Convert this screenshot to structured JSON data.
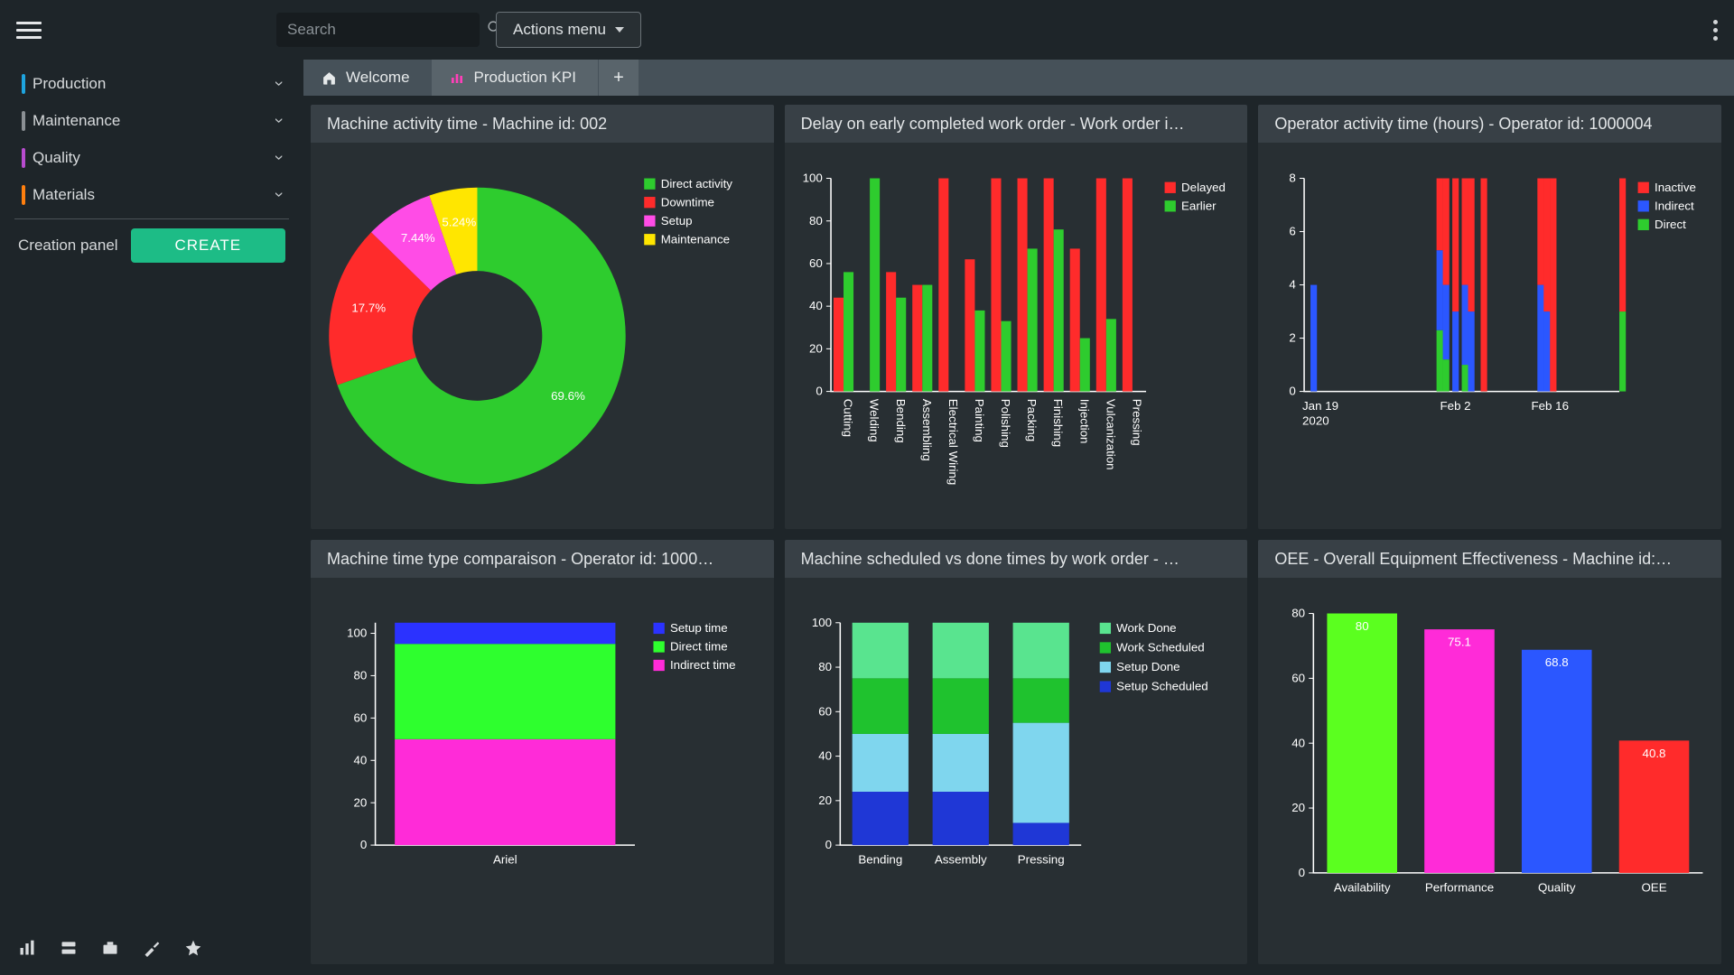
{
  "search": {
    "placeholder": "Search"
  },
  "actions_menu": "Actions menu",
  "sidebar": {
    "items": [
      {
        "label": "Production",
        "color": "#1ea4de"
      },
      {
        "label": "Maintenance",
        "color": "#8b9094"
      },
      {
        "label": "Quality",
        "color": "#b84ccf"
      },
      {
        "label": "Materials",
        "color": "#ff7f0e"
      }
    ],
    "creation_label": "Creation panel",
    "create_btn": "CREATE"
  },
  "tabs": [
    {
      "label": "Welcome",
      "active": false,
      "icon": "home"
    },
    {
      "label": "Production KPI",
      "active": true,
      "icon": "chart"
    }
  ],
  "cards": {
    "machine_activity": {
      "title": "Machine activity time - Machine id: 002"
    },
    "delay": {
      "title": "Delay on early completed work order - Work order i…"
    },
    "operator": {
      "title": "Operator activity time (hours) - Operator id: 1000004"
    },
    "comparaison": {
      "title": "Machine time type comparaison - Operator id: 1000…"
    },
    "scheduled": {
      "title": "Machine scheduled vs done times by work order - …"
    },
    "oee": {
      "title": "OEE - Overall Equipment Effectiveness - Machine id:…"
    }
  },
  "chart_data": [
    {
      "type": "pie",
      "title": "Machine activity time - Machine id: 002",
      "slices": [
        {
          "name": "Direct activity",
          "value": 69.6,
          "color": "#2ecc2e"
        },
        {
          "name": "Downtime",
          "value": 17.7,
          "color": "#ff2b2b"
        },
        {
          "name": "Setup",
          "value": 7.44,
          "color": "#ff4ce6"
        },
        {
          "name": "Maintenance",
          "value": 5.24,
          "color": "#ffe600"
        }
      ]
    },
    {
      "type": "bar",
      "title": "Delay on early completed work order",
      "categories": [
        "Cutting",
        "Welding",
        "Bending",
        "Assembling",
        "Electrical Wiring",
        "Painting",
        "Polishing",
        "Packing",
        "Finishing",
        "Injection",
        "Vulcanization",
        "Pressing"
      ],
      "series": [
        {
          "name": "Delayed",
          "color": "#ff2b2b",
          "values": [
            44,
            0,
            56,
            50,
            100,
            62,
            100,
            100,
            100,
            67,
            100,
            100
          ]
        },
        {
          "name": "Earlier",
          "color": "#2ecc2e",
          "values": [
            56,
            100,
            44,
            50,
            0,
            38,
            33,
            67,
            76,
            25,
            34,
            0
          ]
        }
      ],
      "ylim": [
        0,
        100
      ],
      "yticks": [
        0,
        20,
        40,
        60,
        80,
        100
      ]
    },
    {
      "type": "bar",
      "title": "Operator activity time (hours)",
      "x": [
        "Jan 19 2020",
        "Feb 2",
        "Feb 16"
      ],
      "series": [
        {
          "name": "Inactive",
          "color": "#ff2b2b"
        },
        {
          "name": "Indirect",
          "color": "#2b57ff"
        },
        {
          "name": "Direct",
          "color": "#2ecc2e"
        }
      ],
      "stacked_days": [
        {
          "x": 0.02,
          "seg": [
            [
              "#2b57ff",
              4
            ]
          ]
        },
        {
          "x": 0.42,
          "seg": [
            [
              "#2ecc2e",
              2.3
            ],
            [
              "#2b57ff",
              3
            ],
            [
              "#ff2b2b",
              2.7
            ]
          ]
        },
        {
          "x": 0.44,
          "seg": [
            [
              "#2ecc2e",
              1.2
            ],
            [
              "#2b57ff",
              2.8
            ],
            [
              "#ff2b2b",
              4
            ]
          ]
        },
        {
          "x": 0.47,
          "seg": [
            [
              "#2b57ff",
              3
            ],
            [
              "#ff2b2b",
              5
            ]
          ]
        },
        {
          "x": 0.5,
          "seg": [
            [
              "#2ecc2e",
              1.0
            ],
            [
              "#2b57ff",
              3
            ],
            [
              "#ff2b2b",
              4
            ]
          ]
        },
        {
          "x": 0.52,
          "seg": [
            [
              "#2b57ff",
              3
            ],
            [
              "#ff2b2b",
              5
            ]
          ]
        },
        {
          "x": 0.56,
          "seg": [
            [
              "#ff2b2b",
              8
            ]
          ]
        },
        {
          "x": 0.74,
          "seg": [
            [
              "#2b57ff",
              4
            ],
            [
              "#ff2b2b",
              4
            ]
          ]
        },
        {
          "x": 0.76,
          "seg": [
            [
              "#2b57ff",
              3
            ],
            [
              "#ff2b2b",
              5
            ]
          ]
        },
        {
          "x": 0.78,
          "seg": [
            [
              "#ff2b2b",
              8
            ]
          ]
        },
        {
          "x": 1.0,
          "seg": [
            [
              "#2ecc2e",
              3
            ],
            [
              "#ff2b2b",
              5
            ]
          ]
        }
      ],
      "ylim": [
        0,
        8
      ],
      "yticks": [
        0,
        2,
        4,
        6,
        8
      ]
    },
    {
      "type": "bar",
      "title": "Machine time type comparaison",
      "categories": [
        "Ariel"
      ],
      "series": [
        {
          "name": "Setup time",
          "color": "#2b32ff",
          "values": [
            10
          ]
        },
        {
          "name": "Direct time",
          "color": "#2eff2e",
          "values": [
            45
          ]
        },
        {
          "name": "Indirect time",
          "color": "#ff2bd8",
          "values": [
            50
          ]
        }
      ],
      "stacked": true,
      "ylim": [
        0,
        105
      ],
      "yticks": [
        0,
        20,
        40,
        60,
        80,
        100
      ]
    },
    {
      "type": "bar",
      "title": "Machine scheduled vs done times by work order",
      "categories": [
        "Bending",
        "Assembly",
        "Pressing"
      ],
      "series": [
        {
          "name": "Work Done",
          "color": "#59e48f",
          "values": [
            25,
            25,
            25
          ]
        },
        {
          "name": "Work Scheduled",
          "color": "#1fc22e",
          "values": [
            25,
            25,
            20
          ]
        },
        {
          "name": "Setup Done",
          "color": "#7fd6ee",
          "values": [
            26,
            26,
            45
          ]
        },
        {
          "name": "Setup Scheduled",
          "color": "#1f37d6",
          "values": [
            24,
            24,
            10
          ]
        }
      ],
      "stacked": true,
      "ylim": [
        0,
        100
      ],
      "yticks": [
        0,
        20,
        40,
        60,
        80,
        100
      ]
    },
    {
      "type": "bar",
      "title": "OEE - Overall Equipment Effectiveness",
      "categories": [
        "Availability",
        "Performance",
        "Quality",
        "OEE"
      ],
      "values": [
        80,
        75.1,
        68.8,
        40.8
      ],
      "colors": [
        "#5bff1f",
        "#ff2bd8",
        "#2b57ff",
        "#ff2b2b"
      ],
      "ylim": [
        0,
        80
      ],
      "yticks": [
        0,
        20,
        40,
        60,
        80
      ]
    }
  ]
}
